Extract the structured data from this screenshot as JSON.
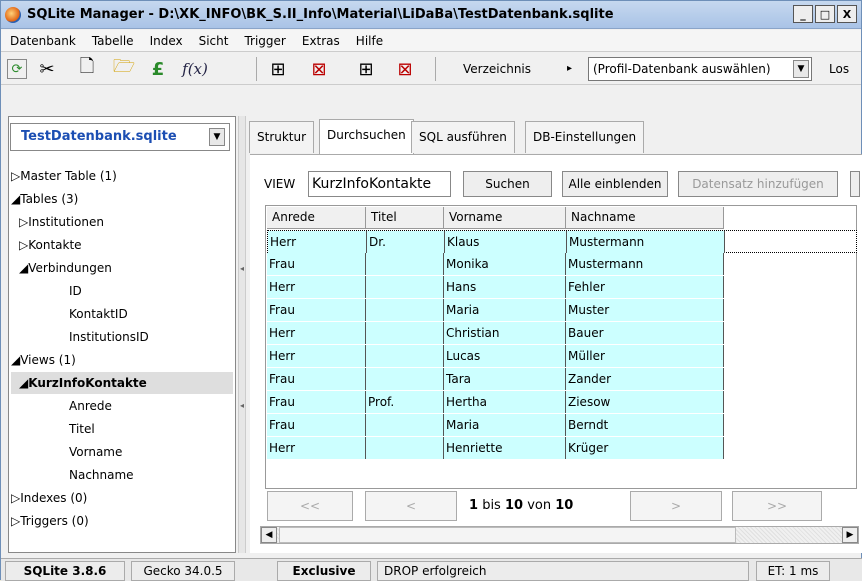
{
  "window": {
    "title": "SQLite Manager - D:\\XK_INFO\\BK_S.II_Info\\Material\\LiDaBa\\TestDatenbank.sqlite",
    "min": "_",
    "max": "□",
    "close": "X"
  },
  "menu": [
    "Datenbank",
    "Tabelle",
    "Index",
    "Sicht",
    "Trigger",
    "Extras",
    "Hilfe"
  ],
  "toolbar": {
    "icons": [
      "refresh-icon",
      "tools-icon",
      "new-file-icon",
      "open-folder-icon",
      "pound-icon",
      "function-icon",
      "table-new-icon",
      "table-delete-icon",
      "index-new-icon",
      "index-delete-icon"
    ],
    "fx_label": "f(x)",
    "directory_label": "Verzeichnis",
    "arrow": "▸",
    "profile_select": "(Profil-Datenbank auswählen)",
    "go_label": "Los"
  },
  "sidebar": {
    "db_select": "TestDatenbank.sqlite",
    "tree": [
      {
        "label": "▷Master Table (1)",
        "indent": 0
      },
      {
        "label": "◢Tables (3)",
        "indent": 0
      },
      {
        "label": "▷Institutionen",
        "indent": 1
      },
      {
        "label": "▷Kontakte",
        "indent": 1
      },
      {
        "label": "◢Verbindungen",
        "indent": 1
      },
      {
        "label": "ID",
        "indent": 2
      },
      {
        "label": "KontaktID",
        "indent": 2
      },
      {
        "label": "InstitutionsID",
        "indent": 2
      },
      {
        "label": "◢Views (1)",
        "indent": 0
      },
      {
        "label": "◢KurzInfoKontakte",
        "indent": 1,
        "selected": true
      },
      {
        "label": "Anrede",
        "indent": 2
      },
      {
        "label": "Titel",
        "indent": 2
      },
      {
        "label": "Vorname",
        "indent": 2
      },
      {
        "label": "Nachname",
        "indent": 2
      },
      {
        "label": "▷Indexes (0)",
        "indent": 0
      },
      {
        "label": "▷Triggers (0)",
        "indent": 0
      }
    ]
  },
  "tabs": [
    "Struktur",
    "Durchsuchen",
    "SQL ausführen",
    "DB-Einstellungen"
  ],
  "active_tab": 1,
  "browse": {
    "view_label": "VIEW",
    "view_name": "KurzInfoKontakte",
    "search_btn": "Suchen",
    "show_all_btn": "Alle einblenden",
    "add_record_btn": "Datensatz hinzufügen",
    "columns": [
      "Anrede",
      "Titel",
      "Vorname",
      "Nachname"
    ],
    "rows": [
      [
        "Herr",
        "Dr.",
        "Klaus",
        "Mustermann"
      ],
      [
        "Frau",
        "",
        "Monika",
        "Mustermann"
      ],
      [
        "Herr",
        "",
        "Hans",
        "Fehler"
      ],
      [
        "Frau",
        "",
        "Maria",
        "Muster"
      ],
      [
        "Herr",
        "",
        "Christian",
        "Bauer"
      ],
      [
        "Herr",
        "",
        "Lucas",
        "Müller"
      ],
      [
        "Frau",
        "",
        "Tara",
        "Zander"
      ],
      [
        "Frau",
        "Prof.",
        "Hertha",
        "Ziesow"
      ],
      [
        "Frau",
        "",
        "Maria",
        "Berndt"
      ],
      [
        "Herr",
        "",
        "Henriette",
        "Krüger"
      ]
    ],
    "pager": {
      "first": "<<",
      "prev": "<",
      "next": ">",
      "last": ">>",
      "from": "1",
      "bis": "bis",
      "to": "10",
      "von": "von",
      "total": "10"
    }
  },
  "status": {
    "version": "SQLite 3.8.6",
    "gecko": "Gecko 34.0.5",
    "mode": "Exclusive",
    "message": "DROP erfolgreich",
    "et": "ET: 1 ms"
  },
  "colors": {
    "row_bg": "#ccffff",
    "db_text": "#1b4eb3",
    "title_bg": "#a9c3e6"
  }
}
